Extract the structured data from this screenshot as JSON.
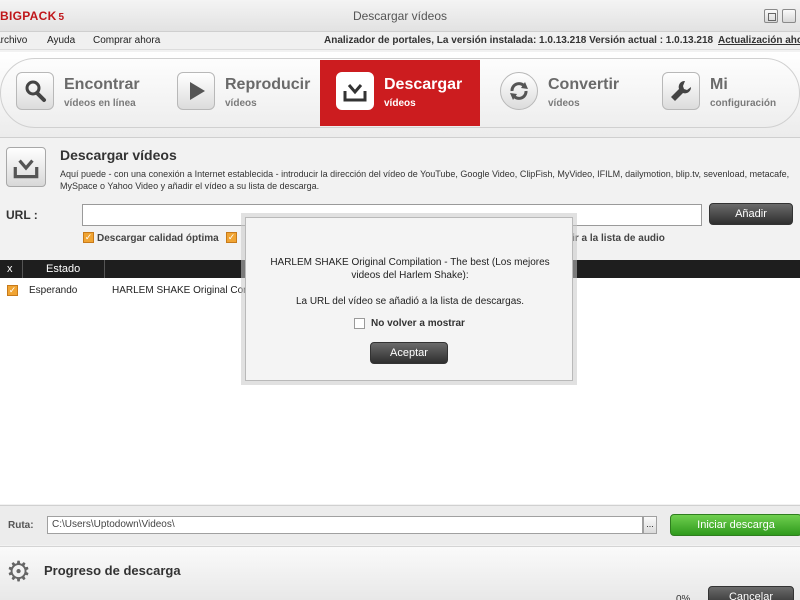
{
  "app": {
    "logo": "BIGPACK",
    "logo_number": "5",
    "window_title": "Descargar vídeos"
  },
  "menu": {
    "items": [
      "Archivo",
      "Ayuda",
      "Comprar ahora"
    ],
    "info": "Analizador de portales, La versión instalada: 1.0.13.218 Versión actual : 1.0.13.218",
    "update_link": "Actualización ahora"
  },
  "nav": [
    {
      "title": "Encontrar",
      "subtitle": "vídeos en línea",
      "icon": "magnifier-icon",
      "active": false
    },
    {
      "title": "Reproducir",
      "subtitle": "vídeos",
      "icon": "play-icon",
      "active": false
    },
    {
      "title": "Descargar",
      "subtitle": "vídeos",
      "icon": "download-tray-icon",
      "active": true
    },
    {
      "title": "Convertir",
      "subtitle": "vídeos",
      "icon": "convert-icon",
      "active": false
    },
    {
      "title": "Mi",
      "subtitle": "configuración",
      "icon": "wrench-icon",
      "active": false
    }
  ],
  "section": {
    "title": "Descargar vídeos",
    "description": "Aquí puede - con una conexión a Internet establecida - introducir la dirección del vídeo de YouTube, Google Video, ClipFish, MyVideo, IFILM, dailymotion, blip.tv, sevenload, metacafe, MySpace o Yahoo Video y añadir el vídeo a su lista de descarga."
  },
  "url_row": {
    "label": "URL :",
    "value": "",
    "add_button": "Añadir",
    "option_quality": "Descargar calidad óptima",
    "option_audio_visible": "dir a la lista de audio"
  },
  "table": {
    "headers": [
      "x",
      "Estado"
    ],
    "rows": [
      {
        "checked": true,
        "status": "Esperando",
        "title": "HARLEM SHAKE Original Com"
      }
    ]
  },
  "route": {
    "label": "Ruta:",
    "path": "C:\\Users\\Uptodown\\Videos\\",
    "browse": "...",
    "start_button": "Iniciar descarga"
  },
  "progress": {
    "title": "Progreso de descarga",
    "percent": "0%",
    "cancel_button": "Cancelar"
  },
  "dialog": {
    "message": "HARLEM SHAKE Original Compilation - The best (Los mejores videos del Harlem Shake):",
    "confirmation": "La URL del vídeo se añadió a la lista de descargas.",
    "dont_show_label": "No volver a mostrar",
    "accept_button": "Aceptar"
  },
  "colors": {
    "accent_red": "#cc1c1f",
    "checkbox_orange": "#f0a433",
    "start_green": "#2f9a1c"
  }
}
